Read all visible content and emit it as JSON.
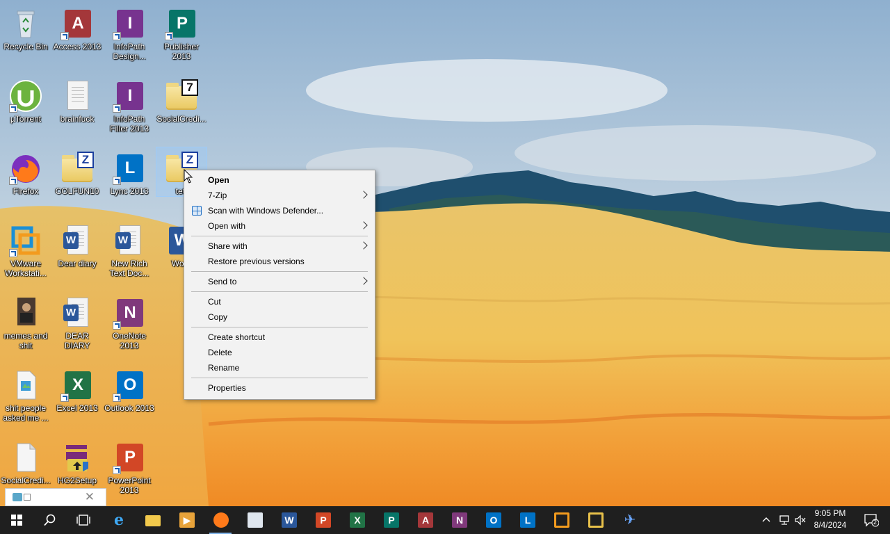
{
  "desktop": {
    "icons": [
      {
        "label": "Recycle Bin"
      },
      {
        "label": "Access 2013"
      },
      {
        "label": "InfoPath Design..."
      },
      {
        "label": "Publisher 2013"
      },
      {
        "label": "µTorrent"
      },
      {
        "label": "brainfuck"
      },
      {
        "label": "InfoPath Filler 2013"
      },
      {
        "label": "SocialCredi..."
      },
      {
        "label": "Firefox"
      },
      {
        "label": "COLFUN10"
      },
      {
        "label": "Lync 2013"
      },
      {
        "label": "tetf"
      },
      {
        "label": "VMware Workstati..."
      },
      {
        "label": "Dear diary"
      },
      {
        "label": "New Rich Text Doc..."
      },
      {
        "label": "Word"
      },
      {
        "label": "memes and shit"
      },
      {
        "label": "DEAR DIARY"
      },
      {
        "label": "OneNote 2013"
      },
      {
        "label": "shit people asked me ..."
      },
      {
        "label": "Excel 2013"
      },
      {
        "label": "Outlook 2013"
      },
      {
        "label": "SocialCredi..."
      },
      {
        "label": "HG2Setup"
      },
      {
        "label": "PowerPoint 2013"
      }
    ],
    "tile_letters": {
      "access": "A",
      "infopath": "I",
      "publisher": "P",
      "lync": "L",
      "word": "W",
      "onenote": "N",
      "excel": "X",
      "outlook": "O",
      "powerpoint": "P",
      "zip": "Z",
      "sevenzip": "7"
    }
  },
  "context_menu": {
    "items": [
      {
        "label": "Open"
      },
      {
        "label": "7-Zip"
      },
      {
        "label": "Scan with Windows Defender..."
      },
      {
        "label": "Open with"
      },
      {
        "label": "Share with"
      },
      {
        "label": "Restore previous versions"
      },
      {
        "label": "Send to"
      },
      {
        "label": "Cut"
      },
      {
        "label": "Copy"
      },
      {
        "label": "Create shortcut"
      },
      {
        "label": "Delete"
      },
      {
        "label": "Rename"
      },
      {
        "label": "Properties"
      }
    ]
  },
  "thumbnail": {
    "close_glyph": "✕"
  },
  "taskbar": {
    "apps": [
      "internet-explorer",
      "file-explorer",
      "media",
      "firefox",
      "sniping",
      "word",
      "powerpoint",
      "excel",
      "publisher",
      "access",
      "onenote",
      "outlook",
      "lync",
      "vmware",
      "hg2",
      "app"
    ],
    "letters": {
      "word": "W",
      "powerpoint": "P",
      "excel": "X",
      "publisher": "P",
      "access": "A",
      "onenote": "N",
      "outlook": "O",
      "lync": "L"
    },
    "clock": {
      "time": "9:05 PM",
      "date": "8/4/2024"
    },
    "notification_count": "2"
  },
  "colors": {
    "taskbar": "#1f1f1f",
    "menu_bg": "#f2f2f2",
    "access": "#a4373a",
    "infopath": "#77338f",
    "publisher": "#077568",
    "word": "#2b579a",
    "excel": "#217346",
    "powerpoint": "#d24726",
    "onenote": "#80397b",
    "outlook": "#0072c6",
    "lync": "#0072c6"
  }
}
